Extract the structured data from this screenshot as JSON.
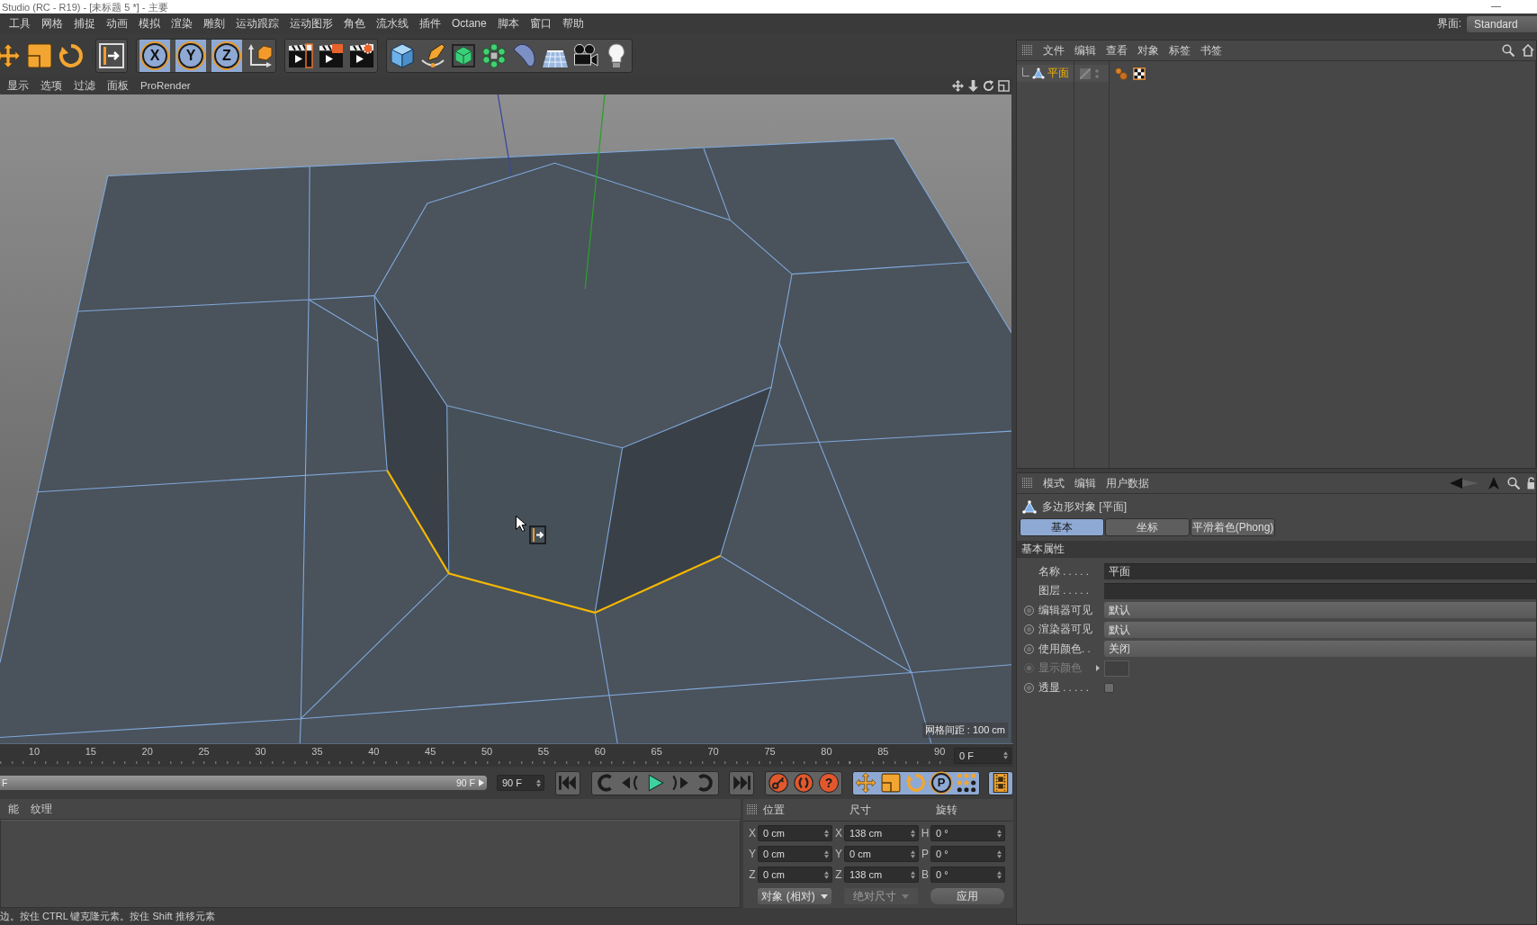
{
  "window": {
    "title": "Studio (RC - R19) - [未标题 5 *] - 主要"
  },
  "menu_bar": {
    "items": [
      "工具",
      "网格",
      "捕捉",
      "动画",
      "模拟",
      "渲染",
      "雕刻",
      "运动跟踪",
      "运动图形",
      "角色",
      "流水线",
      "插件",
      "Octane",
      "脚本",
      "窗口",
      "帮助"
    ],
    "layout_label": "界面:",
    "layout_value": "Standard"
  },
  "toolbar": {
    "axis_locks": [
      {
        "label": "X",
        "on": true
      },
      {
        "label": "Y",
        "on": true
      },
      {
        "label": "Z",
        "on": true
      }
    ]
  },
  "viewport": {
    "menu": [
      "显示",
      "选项",
      "过滤",
      "面板",
      "ProRender"
    ],
    "grid_spacing": "网格间距 : 100 cm"
  },
  "timeline": {
    "ticks": [
      "10",
      "15",
      "20",
      "25",
      "30",
      "35",
      "40",
      "45",
      "50",
      "55",
      "60",
      "65",
      "70",
      "75",
      "80",
      "85",
      "90"
    ],
    "current_frame": "0 F",
    "range_slider": {
      "start": "F",
      "end": "90 F",
      "level": 1
    },
    "end_frame": "90 F",
    "help_label": "?",
    "key_label": "P",
    "key_filters_on": true
  },
  "material_manager": {
    "menu": [
      "能",
      "纹理"
    ]
  },
  "coordinates": {
    "columns": [
      {
        "heading": "位置",
        "fields": [
          {
            "axis": "X",
            "value": "0 cm"
          },
          {
            "axis": "Y",
            "value": "0 cm"
          },
          {
            "axis": "Z",
            "value": "0 cm"
          }
        ]
      },
      {
        "heading": "尺寸",
        "fields": [
          {
            "axis": "X",
            "value": "138 cm"
          },
          {
            "axis": "Y",
            "value": "0 cm"
          },
          {
            "axis": "Z",
            "value": "138 cm"
          }
        ]
      },
      {
        "heading": "旋转",
        "fields": [
          {
            "axis": "H",
            "value": "0 °"
          },
          {
            "axis": "P",
            "value": "0 °"
          },
          {
            "axis": "B",
            "value": "0 °"
          }
        ]
      }
    ],
    "buttons": [
      {
        "label": "对象 (相对)",
        "kind": "dropdown",
        "disabled": false
      },
      {
        "label": "绝对尺寸",
        "kind": "dropdown",
        "disabled": true
      },
      {
        "label": "应用",
        "kind": "button",
        "disabled": false
      }
    ]
  },
  "status_bar": {
    "text": "边。按住 CTRL 键克隆元素。按住 Shift 推移元素"
  },
  "object_manager": {
    "menu": [
      "文件",
      "编辑",
      "查看",
      "对象",
      "标签",
      "书签"
    ],
    "objects": [
      {
        "name": "平面",
        "selected": true
      }
    ]
  },
  "attribute_manager": {
    "menu": [
      "模式",
      "编辑",
      "用户数据"
    ],
    "title": "多边形对象 [平面]",
    "tabs": [
      {
        "label": "基本",
        "selected": true
      },
      {
        "label": "坐标",
        "selected": false
      },
      {
        "label": "平滑着色(Phong)",
        "selected": false
      }
    ],
    "section": "基本属性",
    "fields": [
      {
        "label": "名称 . . . . .",
        "kind": "text",
        "value": "平面",
        "animatable": false,
        "disabled": false
      },
      {
        "label": "图层 . . . . .",
        "kind": "text",
        "animatable": false,
        "disabled": false
      },
      {
        "label": "编辑器可见",
        "kind": "dropdown",
        "value": "默认",
        "animatable": true,
        "disabled": false
      },
      {
        "label": "渲染器可见",
        "kind": "dropdown",
        "value": "默认",
        "animatable": true,
        "disabled": false
      },
      {
        "label": "使用颜色. .",
        "kind": "dropdown",
        "value": "关闭",
        "animatable": true,
        "disabled": false
      },
      {
        "label": "显示颜色",
        "kind": "color",
        "animatable": true,
        "disabled": true
      },
      {
        "label": "透显 . . . . .",
        "kind": "checkbox",
        "checked": false,
        "animatable": true,
        "disabled": false
      }
    ]
  }
}
